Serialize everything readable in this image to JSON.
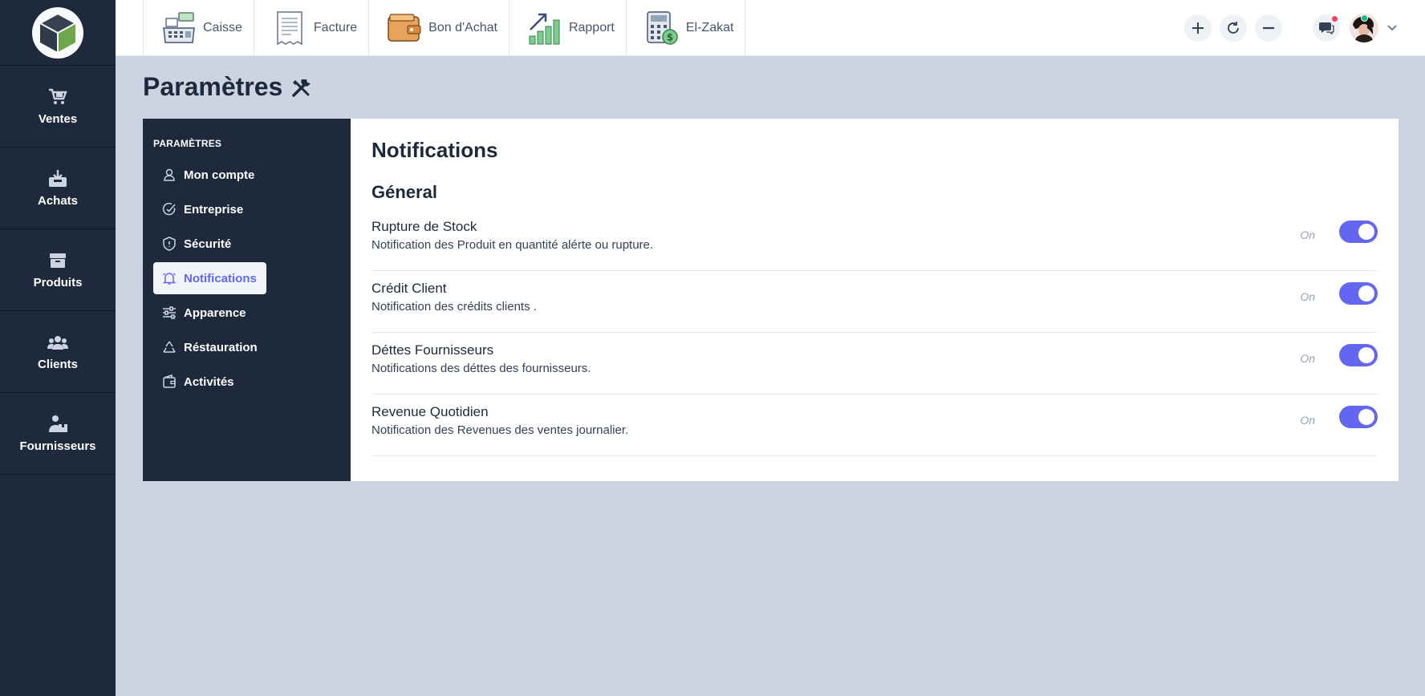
{
  "rail": {
    "items": [
      {
        "label": "Ventes",
        "icon": "cart-icon"
      },
      {
        "label": "Achats",
        "icon": "inbox-download-icon"
      },
      {
        "label": "Produits",
        "icon": "box-icon"
      },
      {
        "label": "Clients",
        "icon": "users-icon"
      },
      {
        "label": "Fournisseurs",
        "icon": "supplier-icon"
      }
    ]
  },
  "topbar": {
    "tools": [
      {
        "label": "Caisse",
        "icon": "cash-register-icon"
      },
      {
        "label": "Facture",
        "icon": "invoice-icon"
      },
      {
        "label": "Bon d'Achat",
        "icon": "wallet-icon"
      },
      {
        "label": "Rapport",
        "icon": "chart-growth-icon"
      },
      {
        "label": "El-Zakat",
        "icon": "calculator-icon"
      }
    ]
  },
  "page": {
    "title": "Paramètres"
  },
  "settings_nav": {
    "heading": "PARAMÈTRES",
    "items": [
      {
        "label": "Mon compte",
        "icon": "user-icon"
      },
      {
        "label": "Entreprise",
        "icon": "check-circle-icon"
      },
      {
        "label": "Sécurité",
        "icon": "shield-icon"
      },
      {
        "label": "Notifications",
        "icon": "bell-icon",
        "active": true
      },
      {
        "label": "Apparence",
        "icon": "sliders-icon"
      },
      {
        "label": "Réstauration",
        "icon": "recycle-icon"
      },
      {
        "label": "Activités",
        "icon": "wallet-small-icon"
      }
    ]
  },
  "content": {
    "title": "Notifications",
    "section": "Géneral",
    "rows": [
      {
        "title": "Rupture de Stock",
        "desc": "Notification des Produit en quantité alérte ou rupture.",
        "state": "On",
        "enabled": true
      },
      {
        "title": "Crédit Client",
        "desc": "Notification des crédits clients .",
        "state": "On",
        "enabled": true
      },
      {
        "title": "Déttes Fournisseurs",
        "desc": "Notifications des déttes des fournisseurs.",
        "state": "On",
        "enabled": true
      },
      {
        "title": "Revenue Quotidien",
        "desc": "Notification des Revenues des ventes journalier.",
        "state": "On",
        "enabled": true
      }
    ]
  },
  "colors": {
    "accent": "#6366f1",
    "rail": "#1e293b",
    "background": "#cbd5e1"
  }
}
